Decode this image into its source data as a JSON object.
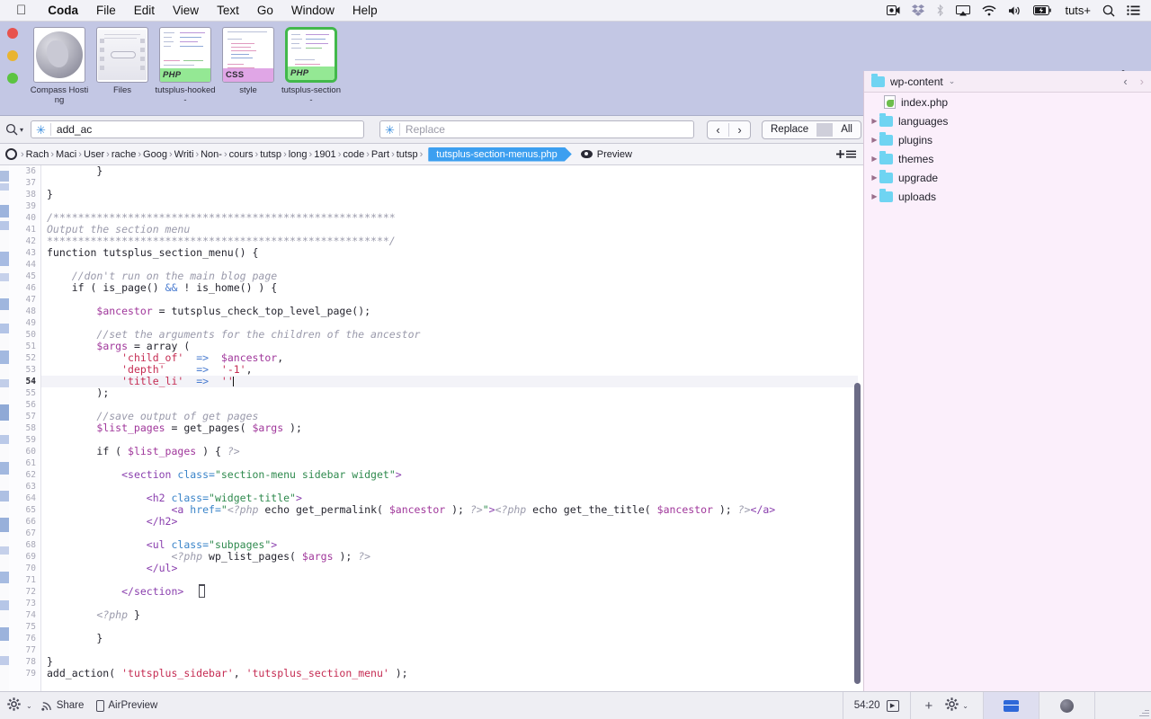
{
  "menubar": {
    "apple": "",
    "items": [
      {
        "label": "Coda",
        "bold": true
      },
      {
        "label": "File"
      },
      {
        "label": "Edit"
      },
      {
        "label": "View"
      },
      {
        "label": "Text"
      },
      {
        "label": "Go"
      },
      {
        "label": "Window"
      },
      {
        "label": "Help"
      }
    ],
    "right": {
      "screen_record": "◉",
      "dropbox": "❖",
      "bluetooth": "✳",
      "airplay": "▭",
      "wifi": "◥",
      "volume": "🔊",
      "battery": "▮",
      "user": "tuts+",
      "search": "⌕",
      "control_center": "☰"
    }
  },
  "tabs": [
    {
      "name": "Compass Hosting",
      "kind": "globe",
      "badge": null,
      "selected": false
    },
    {
      "name": "Files",
      "kind": "files",
      "badge": null,
      "selected": false
    },
    {
      "name": "tutsplus-hooked-",
      "kind": "code",
      "badge": "PHP",
      "selected": false
    },
    {
      "name": "style",
      "kind": "code",
      "badge": "CSS",
      "selected": false
    },
    {
      "name": "tutsplus-section-",
      "kind": "code",
      "badge": "PHP",
      "selected": true
    }
  ],
  "new_tab_label": "+",
  "find": {
    "search_value": "add_ac",
    "replace_placeholder": "Replace",
    "replace_value": "",
    "prev": "‹",
    "next": "›",
    "replace_label": "Replace",
    "all_label": "All",
    "close": "✕",
    "wildcard_icon": "✳"
  },
  "right_toolbar": {
    "items": [
      {
        "icon": "home-icon",
        "active": false
      },
      {
        "icon": "files-icon",
        "active": true
      },
      {
        "icon": "list-icon",
        "active": false
      },
      {
        "icon": "publish-icon",
        "active": false
      }
    ]
  },
  "breadcrumb": {
    "crumbs": [
      "Rach",
      "Maci",
      "User",
      "rache",
      "Goog",
      "Writi",
      "Non-",
      "cours",
      "tutsp",
      "long",
      "1901",
      "code",
      "Part",
      "tutsp"
    ],
    "file": "tutsplus-section-menus.php",
    "file_caret": "⌄",
    "preview_label": "Preview",
    "split_icon": "✛☰"
  },
  "editor": {
    "first_line": 36,
    "current_line": 54,
    "lines": [
      {
        "n": 36,
        "indent": 2,
        "segs": [
          {
            "t": "}",
            "c": "kw"
          }
        ]
      },
      {
        "n": 37,
        "indent": 0,
        "segs": []
      },
      {
        "n": 38,
        "indent": 0,
        "segs": [
          {
            "t": "}",
            "c": "kw"
          }
        ]
      },
      {
        "n": 39,
        "indent": 0,
        "segs": []
      },
      {
        "n": 40,
        "indent": 0,
        "segs": [
          {
            "t": "/*******************************************************",
            "c": "cm"
          }
        ]
      },
      {
        "n": 41,
        "indent": 0,
        "segs": [
          {
            "t": "Output the section menu",
            "c": "cm"
          }
        ]
      },
      {
        "n": 42,
        "indent": 0,
        "segs": [
          {
            "t": "*******************************************************/",
            "c": "cm"
          }
        ]
      },
      {
        "n": 43,
        "indent": 0,
        "segs": [
          {
            "t": "function ",
            "c": "kw"
          },
          {
            "t": "tutsplus_section_menu() {",
            "c": "kw"
          }
        ]
      },
      {
        "n": 44,
        "indent": 0,
        "segs": []
      },
      {
        "n": 45,
        "indent": 1,
        "segs": [
          {
            "t": "//don't run on the main blog page",
            "c": "cm"
          }
        ]
      },
      {
        "n": 46,
        "indent": 1,
        "segs": [
          {
            "t": "if ( is_page() ",
            "c": "kw"
          },
          {
            "t": "&&",
            "c": "op"
          },
          {
            "t": " ! is_home() ) {",
            "c": "kw"
          }
        ]
      },
      {
        "n": 47,
        "indent": 0,
        "segs": []
      },
      {
        "n": 48,
        "indent": 2,
        "segs": [
          {
            "t": "$ancestor",
            "c": "var"
          },
          {
            "t": " = ",
            "c": "kw"
          },
          {
            "t": "tutsplus_check_top_level_page();",
            "c": "kw"
          }
        ]
      },
      {
        "n": 49,
        "indent": 0,
        "segs": []
      },
      {
        "n": 50,
        "indent": 2,
        "segs": [
          {
            "t": "//set the arguments for the children of the ancestor",
            "c": "cm"
          }
        ]
      },
      {
        "n": 51,
        "indent": 2,
        "segs": [
          {
            "t": "$args",
            "c": "var"
          },
          {
            "t": " = array (",
            "c": "kw"
          }
        ]
      },
      {
        "n": 52,
        "indent": 3,
        "segs": [
          {
            "t": "'child_of'",
            "c": "str"
          },
          {
            "t": "  ",
            "c": "kw"
          },
          {
            "t": "=>",
            "c": "op"
          },
          {
            "t": "  ",
            "c": "kw"
          },
          {
            "t": "$ancestor",
            "c": "var"
          },
          {
            "t": ",",
            "c": "kw"
          }
        ]
      },
      {
        "n": 53,
        "indent": 3,
        "segs": [
          {
            "t": "'depth'",
            "c": "str"
          },
          {
            "t": "     ",
            "c": "kw"
          },
          {
            "t": "=>",
            "c": "op"
          },
          {
            "t": "  ",
            "c": "kw"
          },
          {
            "t": "'-1'",
            "c": "str"
          },
          {
            "t": ",",
            "c": "kw"
          }
        ]
      },
      {
        "n": 54,
        "indent": 3,
        "segs": [
          {
            "t": "'title_li'",
            "c": "str"
          },
          {
            "t": "  ",
            "c": "kw"
          },
          {
            "t": "=>",
            "c": "op"
          },
          {
            "t": "  ",
            "c": "kw"
          },
          {
            "t": "''",
            "c": "str"
          }
        ],
        "cursor": true
      },
      {
        "n": 55,
        "indent": 2,
        "segs": [
          {
            "t": ");",
            "c": "kw"
          }
        ]
      },
      {
        "n": 56,
        "indent": 0,
        "segs": []
      },
      {
        "n": 57,
        "indent": 2,
        "segs": [
          {
            "t": "//save output of get pages",
            "c": "cm"
          }
        ]
      },
      {
        "n": 58,
        "indent": 2,
        "segs": [
          {
            "t": "$list_pages",
            "c": "var"
          },
          {
            "t": " = get_pages( ",
            "c": "kw"
          },
          {
            "t": "$args",
            "c": "var"
          },
          {
            "t": " );",
            "c": "kw"
          }
        ]
      },
      {
        "n": 59,
        "indent": 0,
        "segs": []
      },
      {
        "n": 60,
        "indent": 2,
        "segs": [
          {
            "t": "if ( ",
            "c": "kw"
          },
          {
            "t": "$list_pages",
            "c": "var"
          },
          {
            "t": " ) { ",
            "c": "kw"
          },
          {
            "t": "?>",
            "c": "php"
          }
        ]
      },
      {
        "n": 61,
        "indent": 0,
        "segs": []
      },
      {
        "n": 62,
        "indent": 3,
        "segs": [
          {
            "t": "<section ",
            "c": "tag"
          },
          {
            "t": "class=",
            "c": "att"
          },
          {
            "t": "\"section-menu sidebar widget\"",
            "c": "aval"
          },
          {
            "t": ">",
            "c": "tag"
          }
        ]
      },
      {
        "n": 63,
        "indent": 0,
        "segs": []
      },
      {
        "n": 64,
        "indent": 4,
        "segs": [
          {
            "t": "<h2 ",
            "c": "tag"
          },
          {
            "t": "class=",
            "c": "att"
          },
          {
            "t": "\"widget-title\"",
            "c": "aval"
          },
          {
            "t": ">",
            "c": "tag"
          }
        ]
      },
      {
        "n": 65,
        "indent": 5,
        "segs": [
          {
            "t": "<a ",
            "c": "tag"
          },
          {
            "t": "href=",
            "c": "att"
          },
          {
            "t": "\"",
            "c": "aval"
          },
          {
            "t": "<?php",
            "c": "php"
          },
          {
            "t": " echo get_permalink( ",
            "c": "kw"
          },
          {
            "t": "$ancestor",
            "c": "var"
          },
          {
            "t": " ); ",
            "c": "kw"
          },
          {
            "t": "?>",
            "c": "php"
          },
          {
            "t": "\"",
            "c": "aval"
          },
          {
            "t": ">",
            "c": "tag"
          },
          {
            "t": "<?php",
            "c": "php"
          },
          {
            "t": " echo get_the_title( ",
            "c": "kw"
          },
          {
            "t": "$ancestor",
            "c": "var"
          },
          {
            "t": " ); ",
            "c": "kw"
          },
          {
            "t": "?>",
            "c": "php"
          },
          {
            "t": "</a>",
            "c": "tag"
          }
        ]
      },
      {
        "n": 66,
        "indent": 4,
        "segs": [
          {
            "t": "</h2>",
            "c": "tag"
          }
        ]
      },
      {
        "n": 67,
        "indent": 0,
        "segs": []
      },
      {
        "n": 68,
        "indent": 4,
        "segs": [
          {
            "t": "<ul ",
            "c": "tag"
          },
          {
            "t": "class=",
            "c": "att"
          },
          {
            "t": "\"subpages\"",
            "c": "aval"
          },
          {
            "t": ">",
            "c": "tag"
          }
        ]
      },
      {
        "n": 69,
        "indent": 5,
        "segs": [
          {
            "t": "<?php",
            "c": "php"
          },
          {
            "t": " wp_list_pages( ",
            "c": "kw"
          },
          {
            "t": "$args",
            "c": "var"
          },
          {
            "t": " ); ",
            "c": "kw"
          },
          {
            "t": "?>",
            "c": "php"
          }
        ]
      },
      {
        "n": 70,
        "indent": 4,
        "segs": [
          {
            "t": "</ul>",
            "c": "tag"
          }
        ]
      },
      {
        "n": 71,
        "indent": 0,
        "segs": []
      },
      {
        "n": 72,
        "indent": 3,
        "segs": [
          {
            "t": "</section>",
            "c": "tag"
          }
        ]
      },
      {
        "n": 73,
        "indent": 0,
        "segs": []
      },
      {
        "n": 74,
        "indent": 2,
        "segs": [
          {
            "t": "<?php",
            "c": "php"
          },
          {
            "t": " }",
            "c": "kw"
          }
        ]
      },
      {
        "n": 75,
        "indent": 0,
        "segs": []
      },
      {
        "n": 76,
        "indent": 2,
        "segs": [
          {
            "t": "}",
            "c": "kw"
          }
        ]
      },
      {
        "n": 77,
        "indent": 0,
        "segs": []
      },
      {
        "n": 78,
        "indent": 0,
        "segs": [
          {
            "t": "}",
            "c": "kw"
          }
        ]
      },
      {
        "n": 79,
        "indent": 0,
        "segs": [
          {
            "t": "add_action( ",
            "c": "kw"
          },
          {
            "t": "'tutsplus_sidebar'",
            "c": "str"
          },
          {
            "t": ", ",
            "c": "kw"
          },
          {
            "t": "'tutsplus_section_menu'",
            "c": "str"
          },
          {
            "t": " );",
            "c": "kw"
          }
        ]
      }
    ]
  },
  "sidebar": {
    "root": "wp-content",
    "root_caret": "⌄",
    "back": "‹",
    "forward": "›",
    "items": [
      {
        "name": "index.php",
        "type": "file",
        "expandable": false
      },
      {
        "name": "languages",
        "type": "folder",
        "expandable": true
      },
      {
        "name": "plugins",
        "type": "folder",
        "expandable": true
      },
      {
        "name": "themes",
        "type": "folder",
        "expandable": true
      },
      {
        "name": "upgrade",
        "type": "folder",
        "expandable": true
      },
      {
        "name": "uploads",
        "type": "folder",
        "expandable": true
      }
    ]
  },
  "statusbar": {
    "gear": "⚙",
    "gear_caret": "⌄",
    "share_label": "Share",
    "airpreview_label": "AirPreview",
    "position": "54:20",
    "add": "+",
    "settings_gear": "⚙",
    "settings_caret": "⌄"
  },
  "colors": {
    "accent_blue": "#3c9ff0",
    "php_badge": "#94e894",
    "css_badge": "#e0a6e6",
    "tab_selected_border": "#42b84b",
    "tabbar_bg": "#c3c7e4",
    "sidebar_bg": "#fbeffb",
    "dark_toolbar": "#3d3d4a"
  }
}
